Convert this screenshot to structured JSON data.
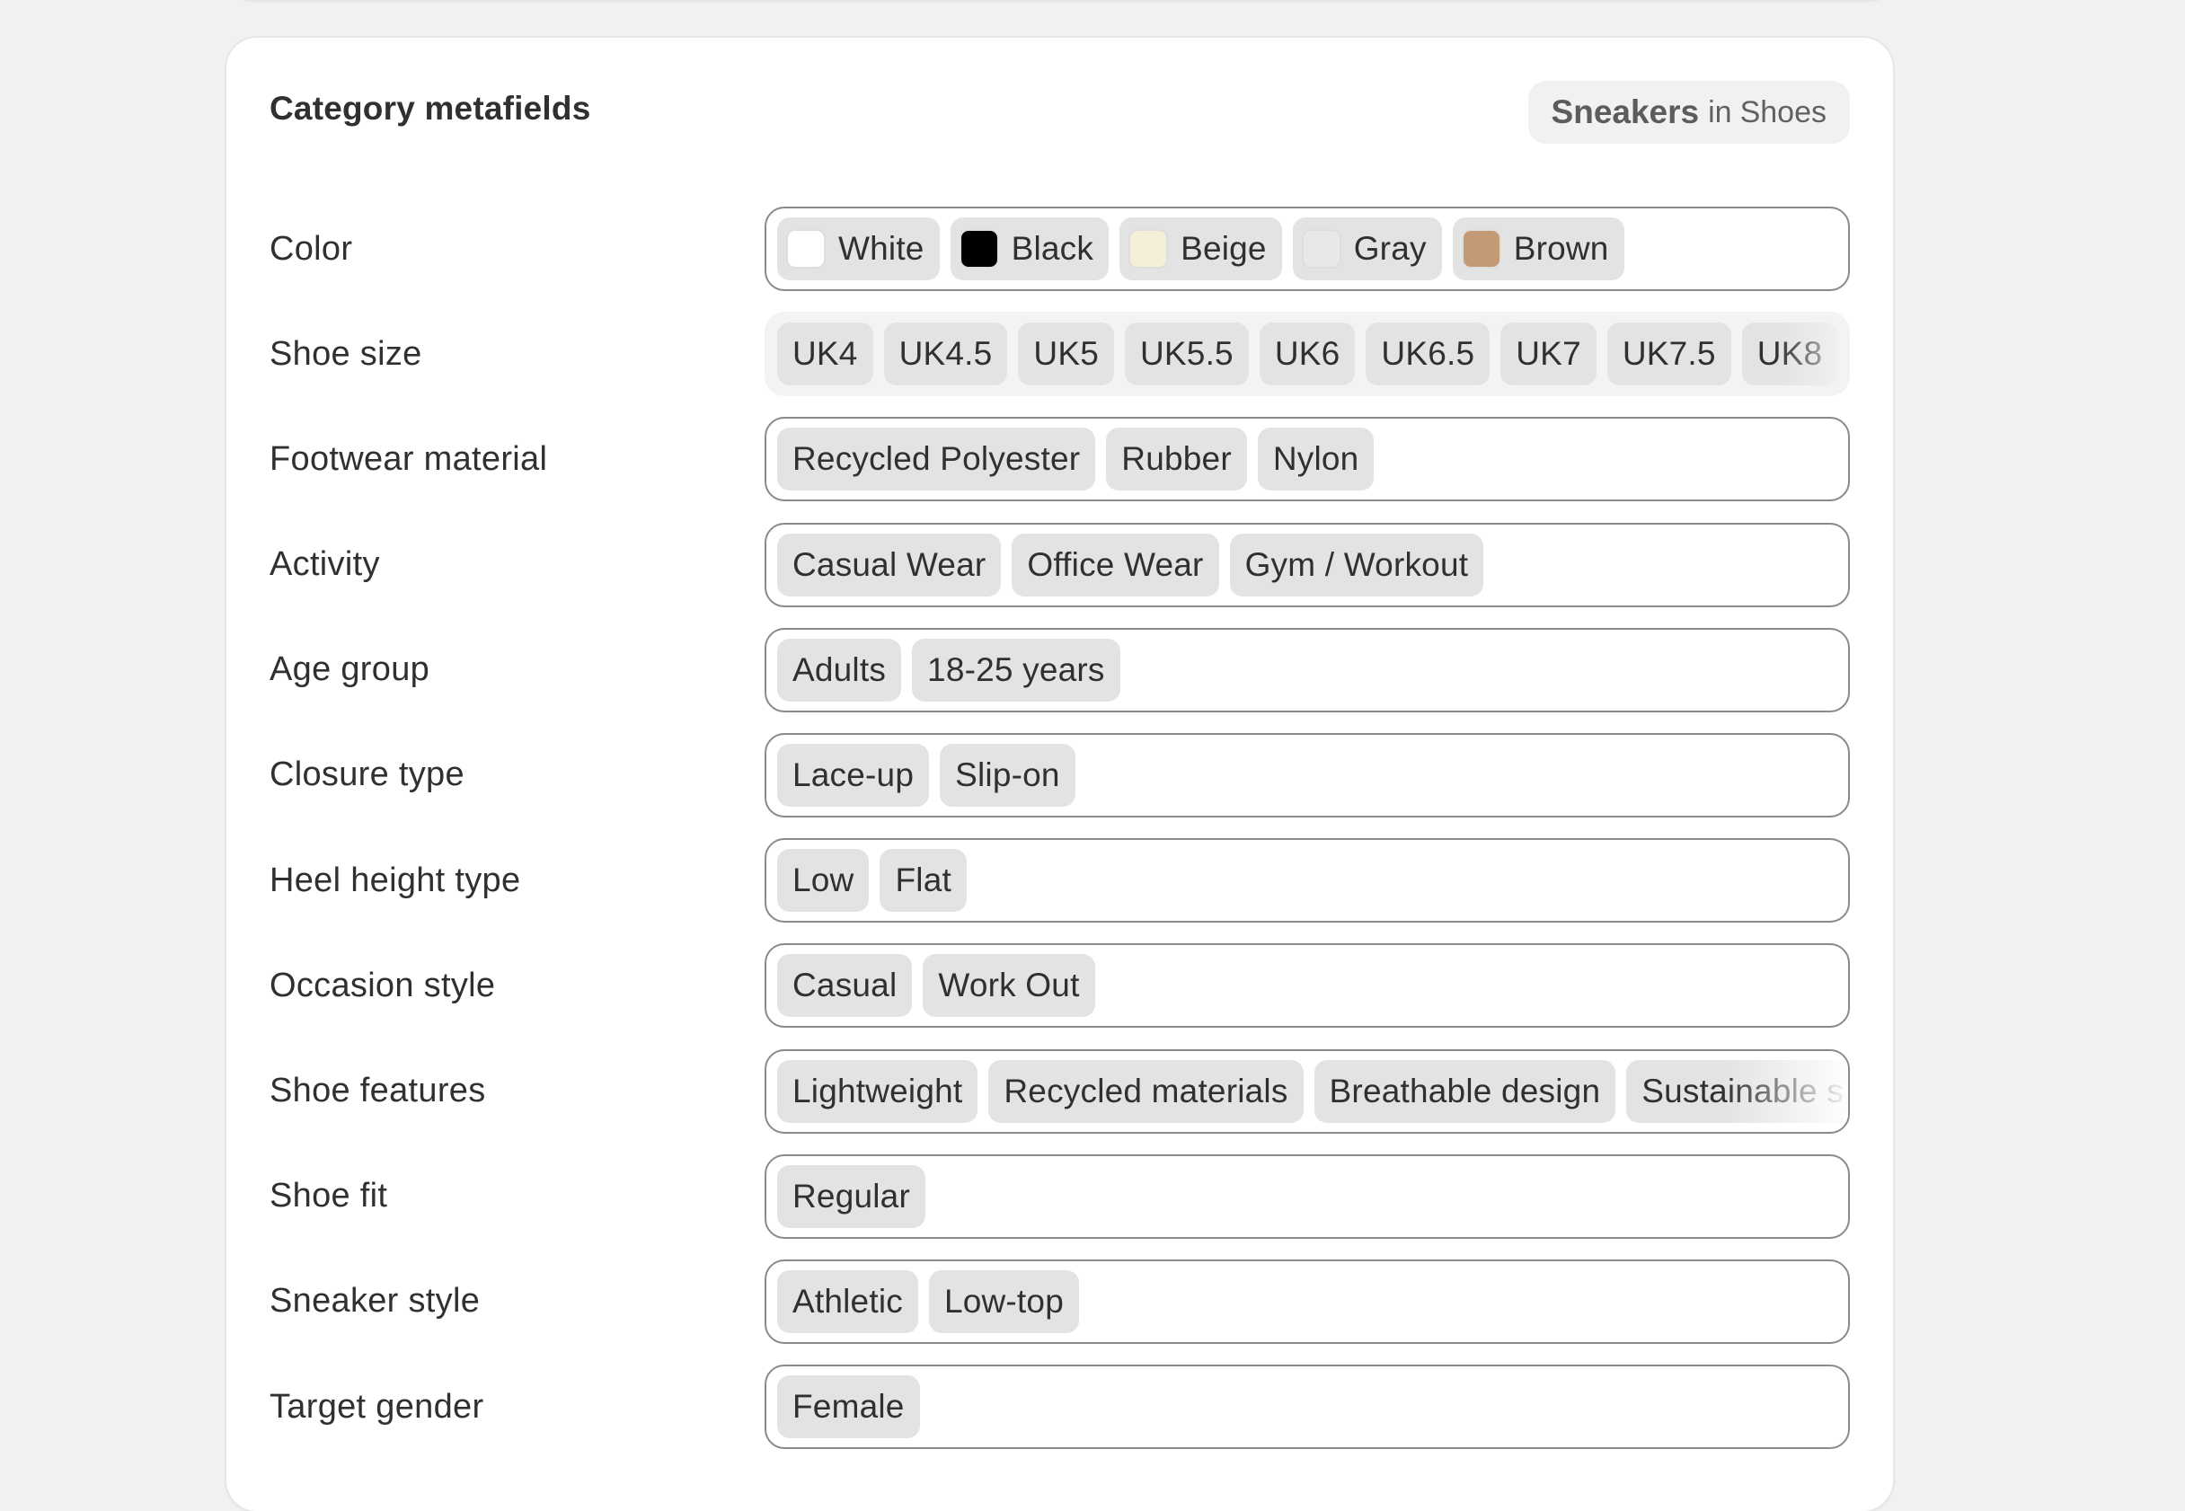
{
  "card": {
    "title": "Category metafields",
    "category": {
      "name": "Sneakers",
      "separator": "in",
      "parent": "Shoes"
    }
  },
  "fields": [
    {
      "label": "Color",
      "values": [
        {
          "text": "White",
          "swatch": "#ffffff"
        },
        {
          "text": "Black",
          "swatch": "#000000"
        },
        {
          "text": "Beige",
          "swatch": "#f5efd9"
        },
        {
          "text": "Gray",
          "swatch": "#e8e8e8"
        },
        {
          "text": "Brown",
          "swatch": "#c49a74"
        }
      ]
    },
    {
      "label": "Shoe size",
      "values": [
        {
          "text": "UK4"
        },
        {
          "text": "UK4.5"
        },
        {
          "text": "UK5"
        },
        {
          "text": "UK5.5"
        },
        {
          "text": "UK6"
        },
        {
          "text": "UK6.5"
        },
        {
          "text": "UK7"
        },
        {
          "text": "UK7.5"
        },
        {
          "text": "UK8"
        }
      ]
    },
    {
      "label": "Footwear material",
      "values": [
        {
          "text": "Recycled Polyester"
        },
        {
          "text": "Rubber"
        },
        {
          "text": "Nylon"
        }
      ]
    },
    {
      "label": "Activity",
      "values": [
        {
          "text": "Casual Wear"
        },
        {
          "text": "Office Wear"
        },
        {
          "text": "Gym / Workout"
        }
      ]
    },
    {
      "label": "Age group",
      "values": [
        {
          "text": "Adults"
        },
        {
          "text": "18-25 years"
        }
      ]
    },
    {
      "label": "Closure type",
      "values": [
        {
          "text": "Lace-up"
        },
        {
          "text": "Slip-on"
        }
      ]
    },
    {
      "label": "Heel height type",
      "values": [
        {
          "text": "Low"
        },
        {
          "text": "Flat"
        }
      ]
    },
    {
      "label": "Occasion style",
      "values": [
        {
          "text": "Casual"
        },
        {
          "text": "Work Out"
        }
      ]
    },
    {
      "label": "Shoe features",
      "values": [
        {
          "text": "Lightweight"
        },
        {
          "text": "Recycled materials"
        },
        {
          "text": "Breathable design"
        },
        {
          "text": "Sustainable s"
        }
      ]
    },
    {
      "label": "Shoe fit",
      "values": [
        {
          "text": "Regular"
        }
      ]
    },
    {
      "label": "Sneaker style",
      "values": [
        {
          "text": "Athletic"
        },
        {
          "text": "Low-top"
        }
      ]
    },
    {
      "label": "Target gender",
      "values": [
        {
          "text": "Female"
        }
      ]
    }
  ]
}
